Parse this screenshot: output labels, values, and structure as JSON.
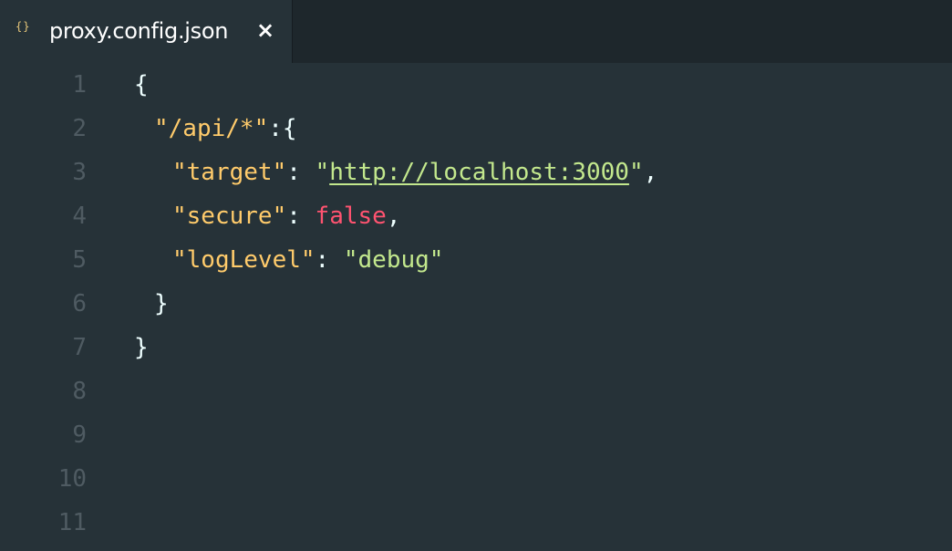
{
  "tab": {
    "icon": "{}",
    "title": "proxy.config.json",
    "close": "×"
  },
  "editor": {
    "line_numbers": [
      "1",
      "2",
      "3",
      "4",
      "5",
      "6",
      "7",
      "8",
      "9",
      "10",
      "11"
    ],
    "code": {
      "open_brace": "{",
      "api_key": "\"/api/*\"",
      "colon": ":",
      "api_open": "{",
      "target_key": "\"target\"",
      "target_q1": "\"",
      "target_url": "http://localhost:3000",
      "target_q2": "\"",
      "comma": ",",
      "secure_key": "\"secure\"",
      "secure_val": "false",
      "loglevel_key": "\"logLevel\"",
      "loglevel_val": "\"debug\"",
      "api_close": "}",
      "close_brace": "}"
    }
  },
  "colors": {
    "background": "#263238",
    "key": "#ffcb6b",
    "string": "#c3e88d",
    "boolean": "#ff5370",
    "line_number": "#4f5b62"
  }
}
